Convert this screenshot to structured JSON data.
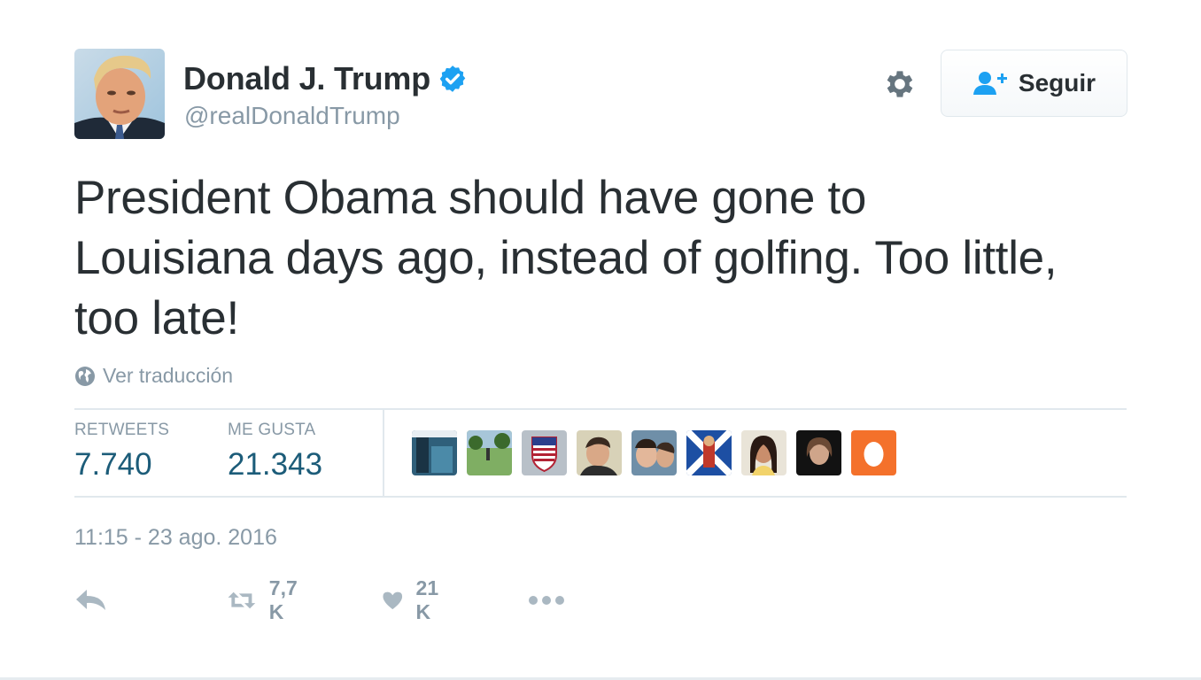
{
  "user": {
    "display_name": "Donald J. Trump",
    "handle": "@realDonaldTrump",
    "verified": true
  },
  "header": {
    "settings_icon": "gear-icon",
    "follow_label": "Seguir",
    "follow_icon": "add-user-icon"
  },
  "tweet": {
    "text": "President Obama should have gone to Louisiana days ago, instead of golfing. Too little, too late!"
  },
  "translate": {
    "icon": "globe-icon",
    "label": "Ver traducción"
  },
  "stats": {
    "retweets_label": "RETWEETS",
    "retweets_value": "7.740",
    "likes_label": "ME GUSTA",
    "likes_value": "21.343"
  },
  "likers": [
    {
      "name": "liker-avatar"
    },
    {
      "name": "liker-avatar"
    },
    {
      "name": "liker-avatar"
    },
    {
      "name": "liker-avatar"
    },
    {
      "name": "liker-avatar"
    },
    {
      "name": "liker-avatar"
    },
    {
      "name": "liker-avatar"
    },
    {
      "name": "liker-avatar"
    },
    {
      "name": "liker-avatar"
    }
  ],
  "timestamp": "11:15 - 23 ago. 2016",
  "actions": {
    "reply_icon": "reply-icon",
    "retweet_icon": "retweet-icon",
    "retweet_count": "7,7 K",
    "like_icon": "heart-icon",
    "like_count": "21 K",
    "more_icon": "more-icon"
  },
  "colors": {
    "text": "#292f33",
    "muted": "#8899a6",
    "link_blue": "#1da1f2",
    "stat_value": "#1c5c79",
    "border": "#e1e8ed"
  }
}
